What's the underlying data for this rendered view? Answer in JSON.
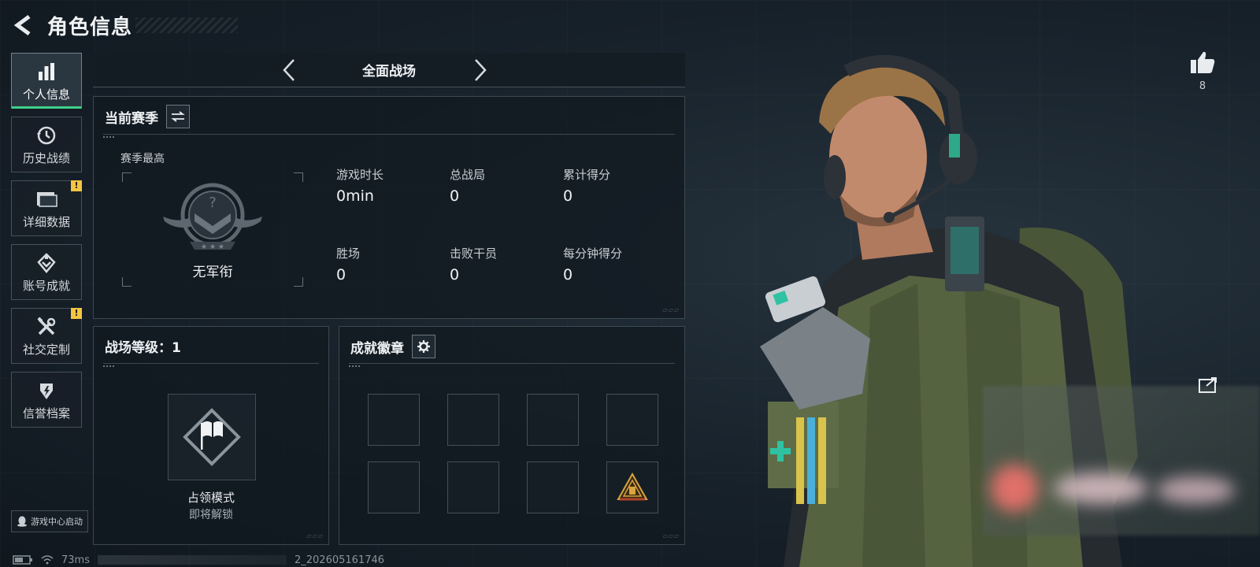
{
  "header": {
    "title": "角色信息"
  },
  "sidebar": {
    "items": [
      {
        "label": "个人信息",
        "icon": "bar-chart-icon",
        "active": true,
        "warning": ""
      },
      {
        "label": "历史战绩",
        "icon": "history-icon",
        "active": false,
        "warning": ""
      },
      {
        "label": "详细数据",
        "icon": "folder-icon",
        "active": false,
        "warning": "!"
      },
      {
        "label": "账号成就",
        "icon": "achievement-icon",
        "active": false,
        "warning": ""
      },
      {
        "label": "社交定制",
        "icon": "tools-icon",
        "active": false,
        "warning": "!"
      },
      {
        "label": "信誉档案",
        "icon": "shield-icon",
        "active": false,
        "warning": ""
      }
    ],
    "launch_label": "游戏中心启动"
  },
  "mode_bar": {
    "title": "全面战场"
  },
  "season": {
    "title": "当前赛季",
    "best_label": "赛季最高",
    "rank_name": "无军衔",
    "stats": [
      {
        "label": "游戏时长",
        "value": "0min"
      },
      {
        "label": "总战局",
        "value": "0"
      },
      {
        "label": "累计得分",
        "value": "0"
      },
      {
        "label": "胜场",
        "value": "0"
      },
      {
        "label": "击败干员",
        "value": "0"
      },
      {
        "label": "每分钟得分",
        "value": "0"
      }
    ]
  },
  "level": {
    "title": "战场等级：1",
    "mode_name": "占领模式",
    "mode_status": "即将解锁"
  },
  "badges": {
    "title": "成就徽章",
    "slots": 8,
    "filled_slot_icon": "pyramid-badge-icon"
  },
  "likes": {
    "count": "8"
  },
  "status": {
    "ping": "73ms",
    "build": "2_202605161746"
  },
  "colors": {
    "accent_green": "#3fd08a",
    "warning_yellow": "#f4c542",
    "background": "#17212a"
  }
}
